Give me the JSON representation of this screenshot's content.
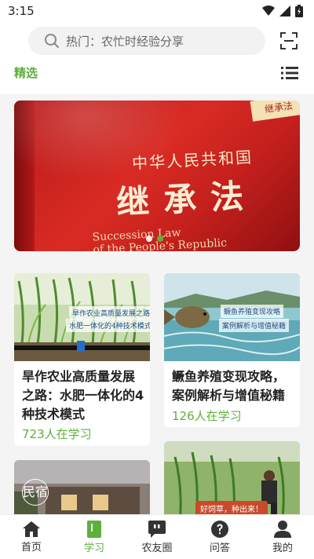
{
  "status": {
    "time": "3:15"
  },
  "search": {
    "placeholder_text": "热门：农忙时经验分享"
  },
  "tabs": {
    "featured": "精选"
  },
  "banner": {
    "book_title_small": "中华人民共和国",
    "book_title_main": "继承法",
    "book_title_en": "Succession Law",
    "book_sub_en": "of the People's Republic",
    "corner_text": "继承法"
  },
  "cards": [
    {
      "title": "旱作农业高质量发展之路：水肥一体化的4种技术模式",
      "count": "723人在学习",
      "caption1": "旱作农业高质量发展之路",
      "caption2": "水肥一体化的4种技术模式"
    },
    {
      "title": "鳜鱼养殖变现攻略，案例解析与增值秘籍",
      "count": "126人在学习",
      "caption1": "鳜鱼养殖变现攻略",
      "caption2": "案例解析与增值秘籍"
    },
    {
      "caption1": "民宿"
    },
    {
      "caption1": "好饲草，种出来！"
    }
  ],
  "nav": {
    "home": "首页",
    "study": "学习",
    "circle": "农友圈",
    "qa": "问答",
    "me": "我的"
  },
  "colors": {
    "accent": "#5db03b"
  }
}
